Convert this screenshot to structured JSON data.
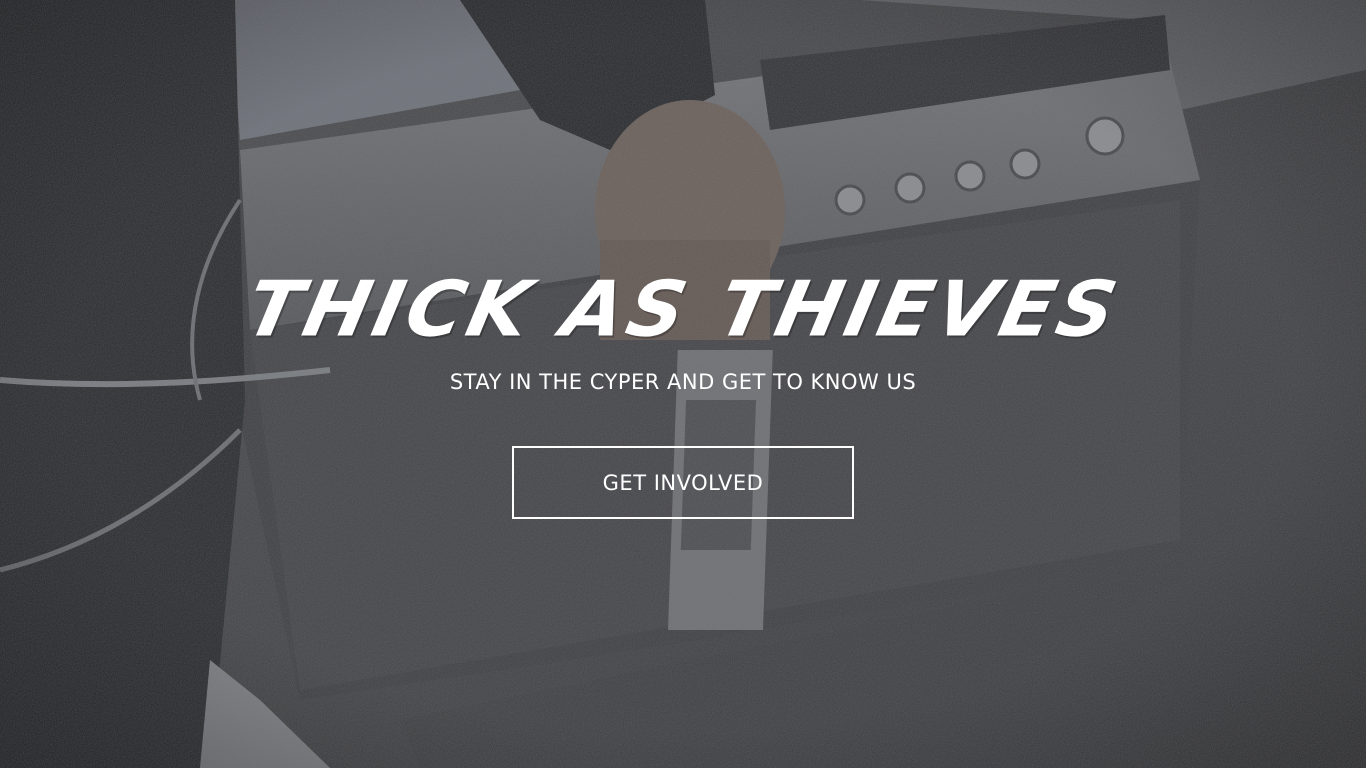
{
  "hero": {
    "title": "THICK AS THIEVES",
    "tagline": "STAY IN THE CYPER AND GET TO KNOW US",
    "cta_label": "GET INVOLVED"
  },
  "colors": {
    "text": "#ffffff",
    "button_border": "#ffffff",
    "background_tone": "#2a2b2e"
  }
}
